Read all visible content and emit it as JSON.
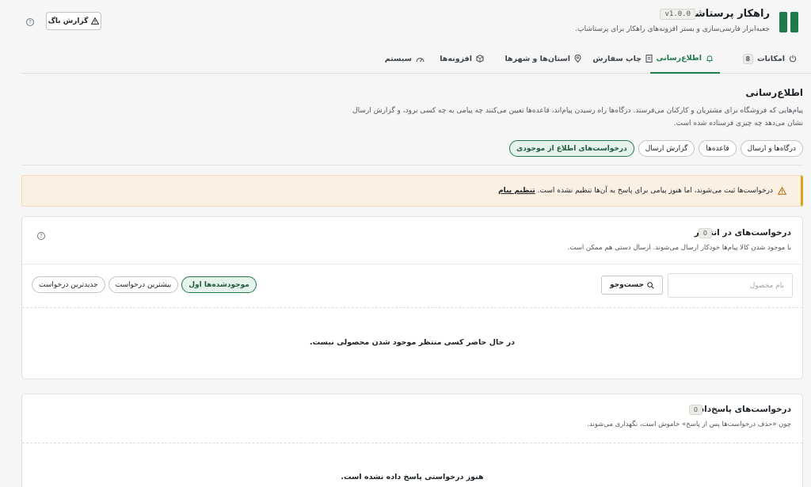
{
  "header": {
    "app_title": "راهکار پرستاشاپ",
    "version": "v1.0.0",
    "subtitle": "جعبه‌ابزار فارسی‌سازی و بستر افزونه‌های راهکار برای پرستاشاپ.",
    "bug_report_label": "گزارش باگ",
    "help_glyph": "?"
  },
  "tabs": [
    {
      "label": "امکانات",
      "count": "8",
      "icon": "power-icon",
      "active": false
    },
    {
      "label": "اطلاع‌رسانی",
      "icon": "bell-icon",
      "active": true
    },
    {
      "label": "چاپ سفارش",
      "icon": "document-icon",
      "active": false
    },
    {
      "label": "استان‌ها و شهرها",
      "icon": "location-pin-icon",
      "active": false
    },
    {
      "label": "افزونه‌ها",
      "icon": "box-icon",
      "active": false
    },
    {
      "label": "سیستم",
      "icon": "gauge-icon",
      "active": false
    }
  ],
  "section": {
    "title": "اطلاع‌رسانی",
    "desc_line1": "پیام‌هایی که فروشگاه برای مشتریان و کارکنان می‌فرستد. درگاه‌ها راه رسیدن پیام‌اند، قاعده‌ها تعیین می‌کنند چه پیامی به چه کسی برود، و گزارش ارسال",
    "desc_line2": "نشان می‌دهد چه چیزی فرستاده شده است."
  },
  "subtabs": [
    {
      "label": "درگاه‌ها و ارسال",
      "active": false
    },
    {
      "label": "قاعده‌ها",
      "active": false
    },
    {
      "label": "گزارش ارسال",
      "active": false
    },
    {
      "label": "درخواست‌های اطلاع از موجودی",
      "active": true
    }
  ],
  "notice": {
    "text": "درخواست‌ها ثبت می‌شوند، اما هنوز پیامی برای پاسخ به آن‌ها تنظیم نشده است.",
    "link": "تنظیم پیام"
  },
  "pending": {
    "title": "درخواست‌های در انتظار",
    "count": "0",
    "subtitle": "با موجود شدن کالا پیام‌ها خودکار ارسال می‌شوند. ارسال دستی هم ممکن است.",
    "search_placeholder": "نام محصول",
    "search_button": "جست‌وجو",
    "sort_options": [
      {
        "label": "موجودشده‌ها اول",
        "active": true
      },
      {
        "label": "بیشترین درخواست",
        "active": false
      },
      {
        "label": "جدیدترین درخواست",
        "active": false
      }
    ],
    "empty_text": "در حال حاضر کسی منتظر موجود شدن محصولی نیست."
  },
  "answered": {
    "title": "درخواست‌های پاسخ‌داده",
    "count": "0",
    "subtitle": "چون «حذف درخواست‌ها پس از پاسخ» خاموش است، نگهداری می‌شوند.",
    "empty_text": "هنوز درخواستی پاسخ داده نشده است."
  },
  "colors": {
    "accent": "#1f7a4a",
    "notice_bg": "#fcf0e3",
    "notice_border": "#dba617"
  }
}
